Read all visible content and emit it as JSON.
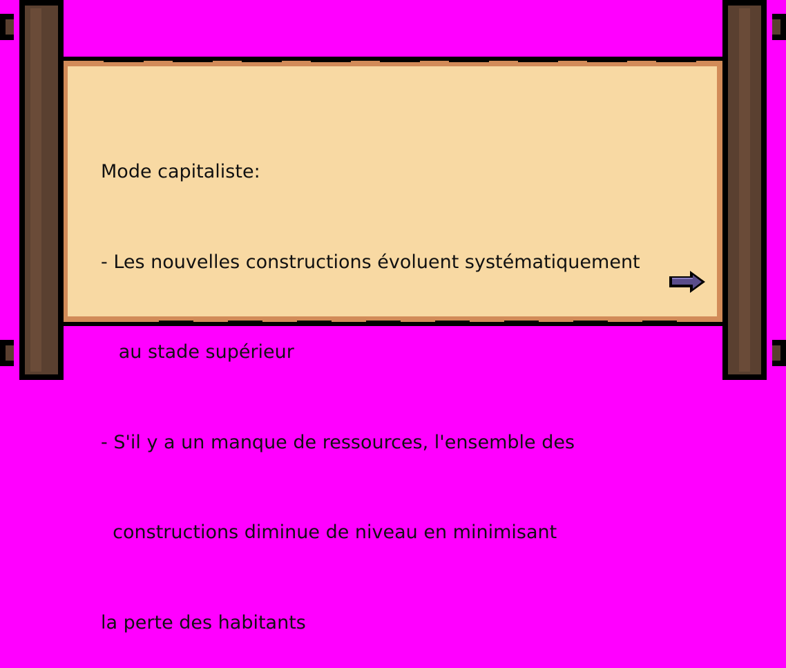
{
  "colors": {
    "background": "#ff00ff",
    "parchment": "#f8d9a3",
    "parchment_edge": "#d28b58",
    "wood": "#5a4030",
    "wood_shadow": "#3f2a1f",
    "outline": "#000000",
    "arrow": "#5a4d8b",
    "text": "#111111"
  },
  "dialog": {
    "lines": [
      "Mode capitaliste:",
      "- Les nouvelles constructions évoluent systématiquement",
      "   au stade supérieur",
      "- S'il y a un manque de ressources, l'ensemble des",
      "  constructions diminue de niveau en minimisant",
      "la perte des habitants"
    ]
  },
  "next_button": {
    "icon": "right-arrow-icon"
  }
}
